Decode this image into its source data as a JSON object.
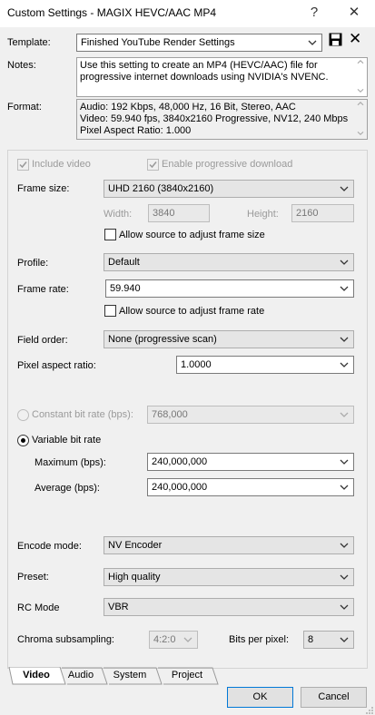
{
  "window": {
    "title": "Custom Settings - MAGIX HEVC/AAC MP4",
    "help_glyph": "?",
    "close_glyph": "✕"
  },
  "template": {
    "label": "Template:",
    "value": "Finished YouTube Render Settings",
    "save_icon": "save-icon",
    "delete_glyph": "✕"
  },
  "notes": {
    "label": "Notes:",
    "lines": [
      "Use this setting to create an MP4 (HEVC/AAC) file for",
      "progressive internet downloads using NVIDIA's NVENC."
    ]
  },
  "format": {
    "label": "Format:",
    "lines": [
      "Audio: 192 Kbps, 48,000 Hz, 16 Bit, Stereo, AAC",
      "Video: 59.940 fps, 3840x2160 Progressive, NV12, 240 Mbps",
      "Pixel Aspect Ratio: 1.000"
    ]
  },
  "video": {
    "include_video": {
      "label": "Include video",
      "checked": true
    },
    "progressive_download": {
      "label": "Enable progressive download",
      "checked": true
    },
    "frame_size": {
      "label": "Frame size:",
      "value": "UHD 2160 (3840x2160)"
    },
    "width": {
      "label": "Width:",
      "value": "3840"
    },
    "height": {
      "label": "Height:",
      "value": "2160"
    },
    "allow_frame_size": {
      "label": "Allow source to adjust frame size",
      "checked": false
    },
    "profile": {
      "label": "Profile:",
      "value": "Default"
    },
    "frame_rate": {
      "label": "Frame rate:",
      "value": "59.940"
    },
    "allow_frame_rate": {
      "label": "Allow source to adjust frame rate",
      "checked": false
    },
    "field_order": {
      "label": "Field order:",
      "value": "None (progressive scan)"
    },
    "pixel_aspect": {
      "label": "Pixel aspect ratio:",
      "value": "1.0000"
    },
    "constant_bitrate": {
      "label": "Constant bit rate (bps):",
      "value": "768,000",
      "selected": false
    },
    "variable_bitrate": {
      "label": "Variable bit rate",
      "selected": true
    },
    "maximum": {
      "label": "Maximum (bps):",
      "value": "240,000,000"
    },
    "average": {
      "label": "Average (bps):",
      "value": "240,000,000"
    },
    "encode_mode": {
      "label": "Encode mode:",
      "value": "NV Encoder"
    },
    "preset": {
      "label": "Preset:",
      "value": "High quality"
    },
    "rc_mode": {
      "label": "RC Mode",
      "value": "VBR"
    },
    "chroma": {
      "label": "Chroma subsampling:",
      "value": "4:2:0"
    },
    "bits_per_pixel": {
      "label": "Bits per pixel:",
      "value": "8"
    }
  },
  "tabs": [
    "Video",
    "Audio",
    "System",
    "Project"
  ],
  "buttons": {
    "ok": "OK",
    "cancel": "Cancel"
  },
  "colors": {
    "accent": "#0078d7",
    "window_bg": "#f0f0f0"
  }
}
